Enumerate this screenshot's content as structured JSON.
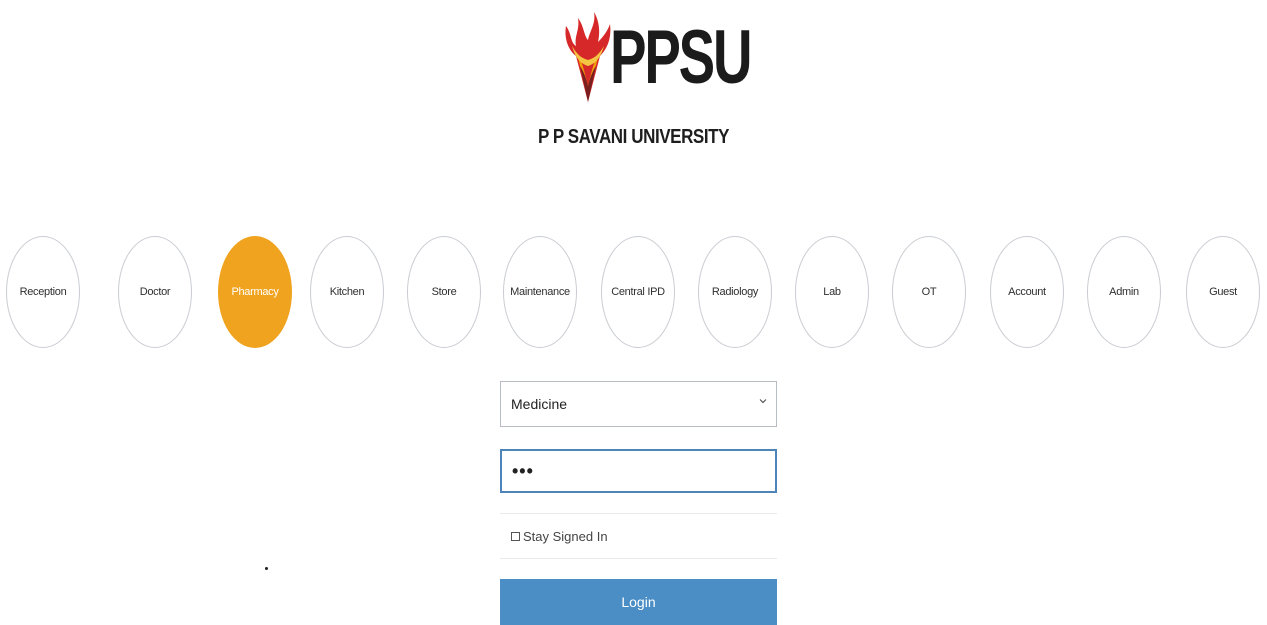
{
  "header": {
    "logo_text": "PPSU",
    "university_name": "P P SAVANI UNIVERSITY"
  },
  "roles": {
    "selected": "Pharmacy",
    "items": [
      {
        "label": "Reception"
      },
      {
        "label": "Doctor"
      },
      {
        "label": "Pharmacy"
      },
      {
        "label": "Kitchen"
      },
      {
        "label": "Store"
      },
      {
        "label": "Maintenance"
      },
      {
        "label": "Central IPD"
      },
      {
        "label": "Radiology"
      },
      {
        "label": "Lab"
      },
      {
        "label": "OT"
      },
      {
        "label": "Account"
      },
      {
        "label": "Admin"
      },
      {
        "label": "Guest"
      }
    ]
  },
  "form": {
    "department_select": {
      "value": "Medicine",
      "icon": "chevron-down-icon"
    },
    "password": {
      "value": "•••"
    },
    "stay_signed_in": {
      "label": "Stay Signed In",
      "checked": false
    },
    "login_label": "Login"
  },
  "colors": {
    "active_role": "#f0a31e",
    "login_button": "#4b8ec6",
    "focus_border": "#4d84b9"
  }
}
